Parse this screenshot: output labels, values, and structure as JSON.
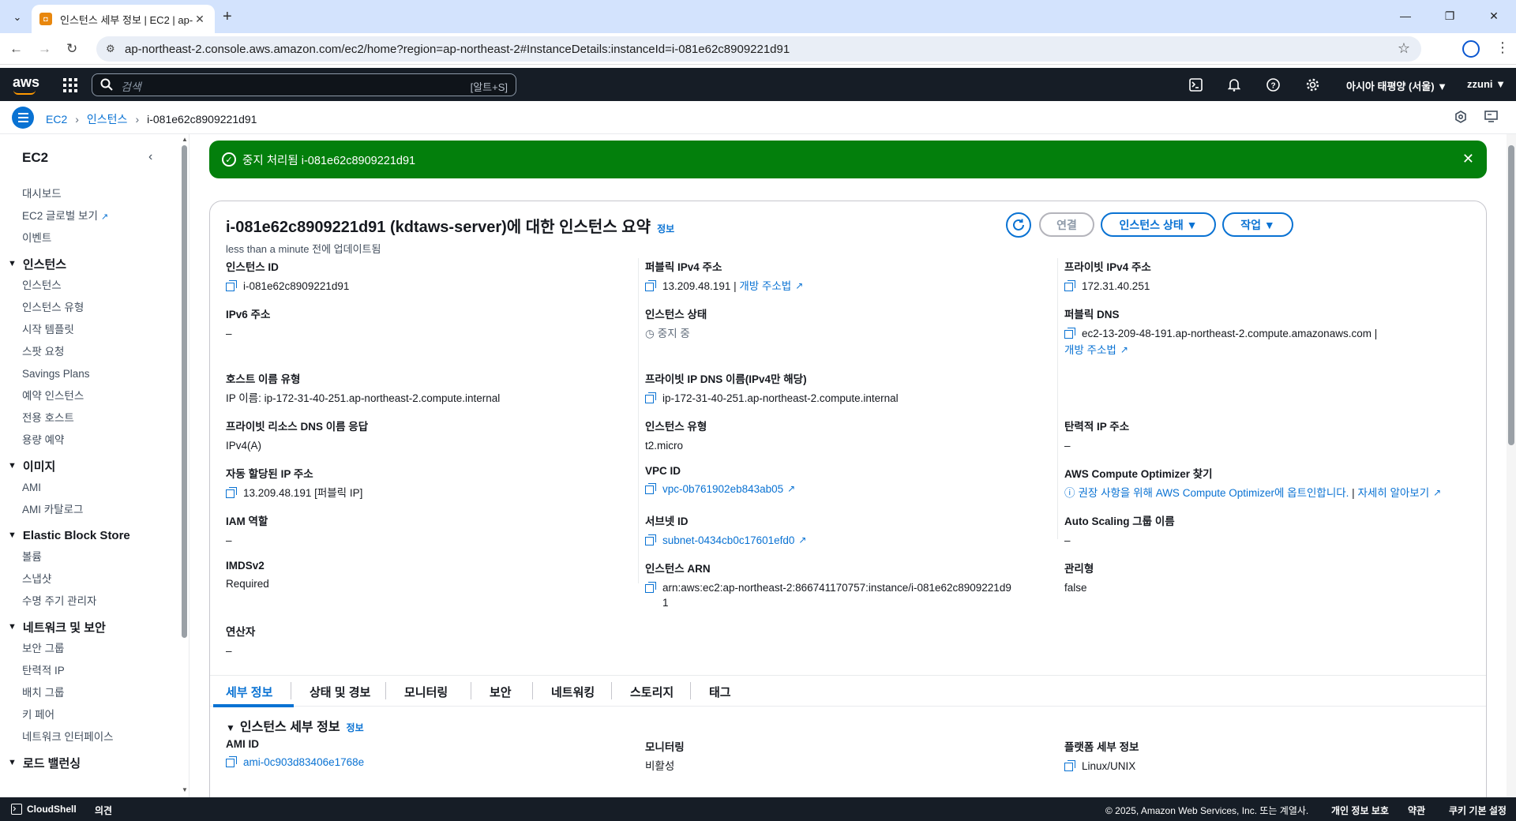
{
  "browser": {
    "tab_title": "인스턴스 세부 정보 | EC2 | ap-",
    "url": "ap-northeast-2.console.aws.amazon.com/ec2/home?region=ap-northeast-2#InstanceDetails:instanceId=i-081e62c8909221d91"
  },
  "header": {
    "logo": "aws",
    "search_placeholder": "검색",
    "search_shortcut": "[알트+S]",
    "region": "아시아 태평양 (서울) ▼",
    "user": "zzuni ▼"
  },
  "breadcrumb": [
    "EC2",
    "인스턴스",
    "i-081e62c8909221d91"
  ],
  "sidebar": {
    "title": "EC2",
    "top_items": [
      "대시보드",
      "EC2 글로벌 보기",
      "이벤트"
    ],
    "sections": [
      {
        "title": "인스턴스",
        "items": [
          "인스턴스",
          "인스턴스 유형",
          "시작 템플릿",
          "스팟 요청",
          "Savings Plans",
          "예약 인스턴스",
          "전용 호스트",
          "용량 예약"
        ]
      },
      {
        "title": "이미지",
        "items": [
          "AMI",
          "AMI 카탈로그"
        ]
      },
      {
        "title": "Elastic Block Store",
        "items": [
          "볼륨",
          "스냅샷",
          "수명 주기 관리자"
        ]
      },
      {
        "title": "네트워크 및 보안",
        "items": [
          "보안 그룹",
          "탄력적 IP",
          "배치 그룹",
          "키 페어",
          "네트워크 인터페이스"
        ]
      },
      {
        "title": "로드 밸런싱",
        "items": []
      }
    ]
  },
  "flash": {
    "message": "중지 처리됨 i-081e62c8909221d91"
  },
  "summary": {
    "title": "i-081e62c8909221d91 (kdtaws-server)에 대한 인스턴스 요약",
    "info": "정보",
    "updated": "less than a minute 전에 업데이트됨",
    "buttons": {
      "connect": "연결",
      "state": "인스턴스 상태 ▼",
      "actions": "작업 ▼"
    },
    "col1": [
      {
        "k": "인스턴스 ID",
        "v": "i-081e62c8909221d91"
      },
      {
        "k": "IPv6 주소",
        "v": "–"
      },
      {
        "k": "호스트 이름 유형",
        "v": "IP 이름: ip-172-31-40-251.ap-northeast-2.compute.internal"
      },
      {
        "k": "프라이빗 리소스 DNS 이름 응답",
        "v": "IPv4(A)"
      },
      {
        "k": "자동 할당된 IP 주소",
        "v": "13.209.48.191 [퍼블릭 IP]"
      },
      {
        "k": "IAM 역할",
        "v": "–"
      },
      {
        "k": "IMDSv2",
        "v": "Required"
      },
      {
        "k": "연산자",
        "v": "–"
      }
    ],
    "col2": [
      {
        "k": "퍼블릭 IPv4 주소",
        "v": "13.209.48.191",
        "link": "개방 주소법"
      },
      {
        "k": "인스턴스 상태",
        "v": "중지 중"
      },
      {
        "k": "프라이빗 IP DNS 이름(IPv4만 해당)",
        "v": "ip-172-31-40-251.ap-northeast-2.compute.internal"
      },
      {
        "k": "인스턴스 유형",
        "v": "t2.micro"
      },
      {
        "k": "VPC ID",
        "v": "vpc-0b761902eb843ab05"
      },
      {
        "k": "서브넷 ID",
        "v": "subnet-0434cb0c17601efd0"
      },
      {
        "k": "인스턴스 ARN",
        "v": "arn:aws:ec2:ap-northeast-2:866741170757:instance/i-081e62c8909221d9",
        "v2": "1"
      }
    ],
    "col3": [
      {
        "k": "프라이빗 IPv4 주소",
        "v": "172.31.40.251"
      },
      {
        "k": "퍼블릭 DNS",
        "v": "ec2-13-209-48-191.ap-northeast-2.compute.amazonaws.com |",
        "link": "개방 주소법"
      },
      {
        "k": "탄력적 IP 주소",
        "v": "–"
      },
      {
        "k": "AWS Compute Optimizer 찾기",
        "v": "권장 사항을 위해 AWS Compute Optimizer에 옵트인합니다.",
        "link": "자세히 알아보기"
      },
      {
        "k": "Auto Scaling 그룹 이름",
        "v": "–"
      },
      {
        "k": "관리형",
        "v": "false"
      }
    ]
  },
  "tabs": [
    "세부 정보",
    "상태 및 경보",
    "모니터링",
    "보안",
    "네트워킹",
    "스토리지",
    "태그"
  ],
  "details": {
    "title": "인스턴스 세부 정보",
    "info": "정보",
    "items": [
      {
        "k": "AMI ID",
        "v": "ami-0c903d83406e1768e"
      },
      {
        "k": "모니터링",
        "v": "비활성"
      },
      {
        "k": "플랫폼 세부 정보",
        "v": "Linux/UNIX"
      }
    ]
  },
  "footer": {
    "cloudshell": "CloudShell",
    "feedback": "의견",
    "copyright": "© 2025, Amazon Web Services, Inc. 또는 계열사.",
    "privacy": "개인 정보 보호",
    "terms": "약관",
    "cookies": "쿠키 기본 설정"
  },
  "colors": {
    "accent": "#0972d3",
    "success": "#037f0c",
    "nav_bg": "#161d26"
  }
}
